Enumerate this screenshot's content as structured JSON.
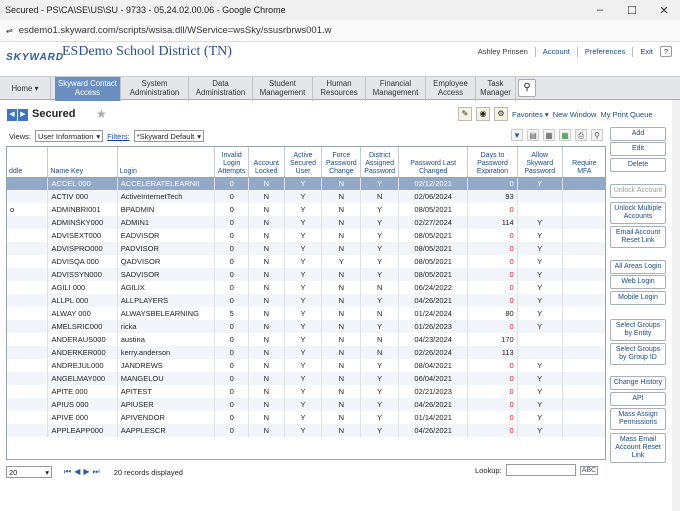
{
  "window": {
    "title": "Secured - PS\\CA\\SE\\US\\SU - 9733 - 05.24.02.00.06 - Google Chrome",
    "minimize": "–",
    "maximize": "☐",
    "close": "✕"
  },
  "address": {
    "url": "esdemo1.skyward.com/scripts/wsisa.dll/WService=wsSky/ssusrbrws001.w",
    "icon": "⇌"
  },
  "header": {
    "logo": "SKYWARD",
    "district": "ESDemo School District (TN)",
    "user": "Ashley Prinsen",
    "links": [
      "Account",
      "Preferences",
      "Exit"
    ],
    "help": "?"
  },
  "nav": [
    {
      "label": "Home ▾"
    },
    {
      "label": "Skyward Contact Access"
    },
    {
      "label": "System Administration"
    },
    {
      "label": "Data Administration"
    },
    {
      "label": "Student Management"
    },
    {
      "label": "Human Resources"
    },
    {
      "label": "Financial Management"
    },
    {
      "label": "Employee Access"
    },
    {
      "label": "Task Manager"
    }
  ],
  "page": {
    "title": "Secured",
    "star": "★",
    "favorites": "Favorites ▾",
    "new_window": "New Window",
    "print_queue": "My Print Queue"
  },
  "views": {
    "label": "Views:",
    "value": "User Information",
    "filters_label": "Filters:",
    "filter_value": "*Skyward Default"
  },
  "columns": [
    "ddle",
    "Name Key",
    "Login",
    "Invalid Login Attempts",
    "Account Locked",
    "Active Secured User",
    "Force Password Change",
    "District Assigned Password",
    "Password Last Changed",
    "Days to Password Expiration",
    "Allow Skyward Password",
    "Require MFA"
  ],
  "rows": [
    [
      "",
      "ACCEL 000",
      "ACCELERATELEARNII",
      "0",
      "N",
      "Y",
      "N",
      "Y",
      "02/12/2021",
      "0",
      "Y",
      ""
    ],
    [
      "",
      "ACTIV 000",
      "ActiveInternetTech",
      "0",
      "N",
      "Y",
      "N",
      "N",
      "02/06/2024",
      "93",
      "",
      ""
    ],
    [
      "o",
      "ADMINBRI001",
      "BPADMIN",
      "0",
      "N",
      "Y",
      "N",
      "Y",
      "08/05/2021",
      "0",
      "",
      ""
    ],
    [
      "",
      "ADMINSKY000",
      "ADMIN1",
      "0",
      "N",
      "Y",
      "N",
      "Y",
      "02/27/2024",
      "114",
      "Y",
      ""
    ],
    [
      "",
      "ADVISEXT000",
      "EADVISOR",
      "0",
      "N",
      "Y",
      "N",
      "Y",
      "08/05/2021",
      "0",
      "Y",
      ""
    ],
    [
      "",
      "ADVISPRO000",
      "PADVISOR",
      "0",
      "N",
      "Y",
      "N",
      "Y",
      "08/05/2021",
      "0",
      "Y",
      ""
    ],
    [
      "",
      "ADVISQA 000",
      "QADVISOR",
      "0",
      "N",
      "Y",
      "Y",
      "Y",
      "08/05/2021",
      "0",
      "Y",
      ""
    ],
    [
      "",
      "ADVISSYN000",
      "SADVISOR",
      "0",
      "N",
      "Y",
      "N",
      "Y",
      "08/05/2021",
      "0",
      "Y",
      ""
    ],
    [
      "",
      "AGILI 000",
      "AGILIX",
      "0",
      "N",
      "Y",
      "N",
      "N",
      "06/24/2022",
      "0",
      "Y",
      ""
    ],
    [
      "",
      "ALLPL 000",
      "ALLPLAYERS",
      "0",
      "N",
      "Y",
      "N",
      "Y",
      "04/26/2021",
      "0",
      "Y",
      ""
    ],
    [
      "",
      "ALWAY 000",
      "ALWAYSBELEARNING",
      "5",
      "N",
      "Y",
      "N",
      "N",
      "01/24/2024",
      "80",
      "Y",
      ""
    ],
    [
      "",
      "AMELSRIC000",
      "ricka",
      "0",
      "N",
      "Y",
      "N",
      "Y",
      "01/26/2023",
      "0",
      "Y",
      ""
    ],
    [
      "",
      "ANDERAUS000",
      "austina",
      "0",
      "N",
      "Y",
      "N",
      "N",
      "04/23/2024",
      "170",
      "",
      ""
    ],
    [
      "",
      "ANDERKER000",
      "kerry.anderson",
      "0",
      "N",
      "Y",
      "N",
      "N",
      "02/26/2024",
      "113",
      "",
      ""
    ],
    [
      "",
      "ANDREJUL000",
      "JANDREWS",
      "0",
      "N",
      "Y",
      "N",
      "Y",
      "08/04/2021",
      "0",
      "Y",
      ""
    ],
    [
      "",
      "ANGELMAY000",
      "MANGELOU",
      "0",
      "N",
      "Y",
      "N",
      "Y",
      "06/04/2021",
      "0",
      "Y",
      ""
    ],
    [
      "",
      "APITE 000",
      "APITEST",
      "0",
      "N",
      "Y",
      "N",
      "Y",
      "02/21/2023",
      "0",
      "Y",
      ""
    ],
    [
      "",
      "APIUS 000",
      "APIUSER",
      "0",
      "N",
      "Y",
      "N",
      "Y",
      "04/26/2021",
      "0",
      "Y",
      ""
    ],
    [
      "",
      "APIVE 000",
      "APIVENDOR",
      "0",
      "N",
      "Y",
      "N",
      "Y",
      "01/14/2021",
      "0",
      "Y",
      ""
    ],
    [
      "",
      "APPLEAPP000",
      "AAPPLESCR",
      "0",
      "N",
      "Y",
      "N",
      "Y",
      "04/26/2021",
      "0",
      "Y",
      ""
    ]
  ],
  "footer": {
    "per_page": "20",
    "records": "20 records displayed",
    "lookup_label": "Lookup:",
    "abc": "ABC"
  },
  "side_buttons": [
    {
      "label": "Add",
      "enabled": true
    },
    {
      "label": "Edit",
      "enabled": true
    },
    {
      "label": "Delete",
      "enabled": true
    },
    {
      "label": "Unlock Account",
      "enabled": false
    },
    {
      "label": "Unlock Multiple Accounts",
      "enabled": true
    },
    {
      "label": "Email Account Reset Link",
      "enabled": true
    },
    {
      "label": "All Areas Login",
      "enabled": true
    },
    {
      "label": "Web Login",
      "enabled": true
    },
    {
      "label": "Mobile Login",
      "enabled": true
    },
    {
      "label": "Select Groups by Entity",
      "enabled": true
    },
    {
      "label": "Select Groups by Group ID",
      "enabled": true
    },
    {
      "label": "Change History",
      "enabled": true
    },
    {
      "label": "API",
      "enabled": true
    },
    {
      "label": "Mass Assign Permissions",
      "enabled": true
    },
    {
      "label": "Mass Email Account Reset Link",
      "enabled": true
    }
  ]
}
